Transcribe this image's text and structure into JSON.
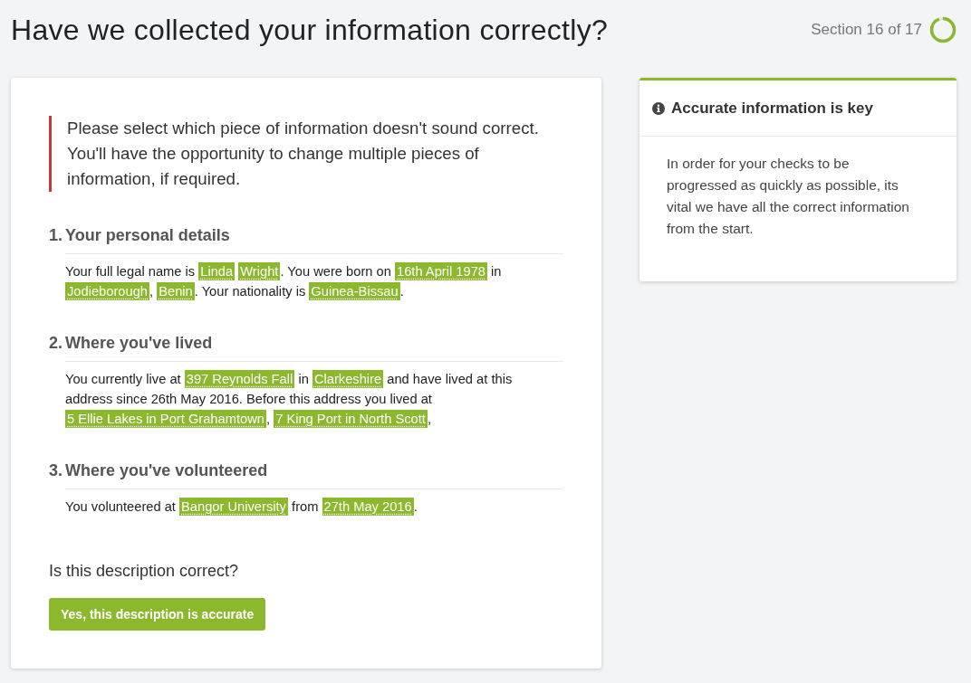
{
  "header": {
    "title": "Have we collected your information correctly?",
    "progress": {
      "label": "Section 16 of 17",
      "level": 0.94
    }
  },
  "review": {
    "notice": "Please select which piece of information doesn't sound correct. You'll have the opportunity to change multiple pieces of information, if required.",
    "sections": [
      {
        "number": "1.",
        "title": "Your personal details",
        "parts": [
          {
            "kind": "text",
            "text": "Your full legal name is "
          },
          {
            "kind": "link",
            "text": "Linda"
          },
          {
            "kind": "link",
            "text": "Wright"
          },
          {
            "kind": "text",
            "text": ". You were born on "
          },
          {
            "kind": "link",
            "text": "16th April 1978"
          },
          {
            "kind": "text",
            "text": " in "
          },
          {
            "kind": "link",
            "text": "Jodieborough"
          },
          {
            "kind": "text",
            "text": ", "
          },
          {
            "kind": "link",
            "text": "Benin"
          },
          {
            "kind": "text",
            "text": ". Your nationality is "
          },
          {
            "kind": "link",
            "text": "Guinea-Bissau"
          },
          {
            "kind": "text",
            "text": "."
          }
        ]
      },
      {
        "number": "2.",
        "title": "Where you've lived",
        "parts": [
          {
            "kind": "text",
            "text": "You currently live at "
          },
          {
            "kind": "link",
            "text": "397 Reynolds Fall"
          },
          {
            "kind": "text",
            "text": " in "
          },
          {
            "kind": "link",
            "text": "Clarkeshire"
          },
          {
            "kind": "text",
            "text": " and have lived at this address since 26th May 2016. Before this address you lived at "
          },
          {
            "kind": "link",
            "text": "5 Ellie Lakes in Port Grahamtown"
          },
          {
            "kind": "text",
            "text": ", "
          },
          {
            "kind": "link",
            "text": "7 King Port in North Scott"
          },
          {
            "kind": "text",
            "text": ","
          }
        ]
      },
      {
        "number": "3.",
        "title": "Where you've volunteered",
        "parts": [
          {
            "kind": "text",
            "text": "You volunteered at "
          },
          {
            "kind": "link",
            "text": "Bangor University"
          },
          {
            "kind": "text",
            "text": " from "
          },
          {
            "kind": "link",
            "text": "27th May 2016"
          },
          {
            "kind": "text",
            "text": "."
          }
        ]
      }
    ],
    "question": "Is this description correct?",
    "confirm_button": "Yes, this description is accurate"
  },
  "info_panel": {
    "title": "Accurate information is key",
    "body": "In order for your checks to be progressed as quickly as possible, its vital we have all the correct information from the start."
  }
}
